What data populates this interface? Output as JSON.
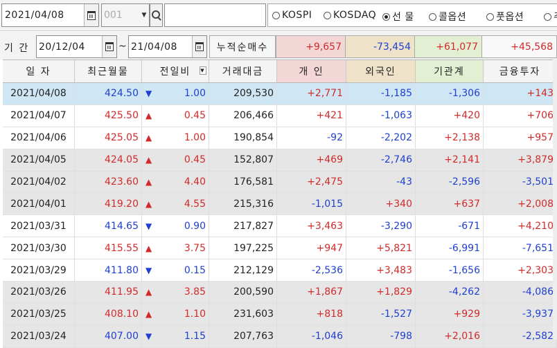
{
  "toolbar": {
    "date": "2021/04/08",
    "code": "001",
    "name": "",
    "markets": [
      {
        "label": "KOSPI",
        "selected": false
      },
      {
        "label": "KOSDAQ",
        "selected": false
      },
      {
        "label": "선 물",
        "selected": true
      },
      {
        "label": "콜옵션",
        "selected": false
      },
      {
        "label": "풋옵션",
        "selected": false
      },
      {
        "label": "주",
        "selected": false
      }
    ]
  },
  "period": {
    "label": "기 간",
    "from": "20/12/04",
    "separator": "~",
    "to": "21/04/08",
    "cum_label": "누적순매수",
    "totals": [
      "+9,657",
      "-73,454",
      "+61,077",
      "+45,568"
    ]
  },
  "colors": {
    "individual": "#f3d7d7",
    "foreign": "#eee3c8",
    "institution": "#e2efd2",
    "selected_row": "#cfe6f5",
    "shade_row": "#e6e6e6",
    "up": "#d22a2a",
    "down": "#1f3fd0"
  },
  "table": {
    "headers": [
      "일 자",
      "최근월물",
      "전일비",
      "거래대금",
      "개 인",
      "외국인",
      "기관계",
      "금융투자"
    ],
    "rows": [
      {
        "date": "2021/04/08",
        "price": "424.50",
        "dir": "down",
        "chg": "1.00",
        "vol": "209,530",
        "ind": "+2,771",
        "frn": "-1,185",
        "inst": "-1,306",
        "fin": "+143"
      },
      {
        "date": "2021/04/07",
        "price": "425.50",
        "dir": "up",
        "chg": "0.45",
        "vol": "206,466",
        "ind": "+421",
        "frn": "-1,063",
        "inst": "+420",
        "fin": "+706"
      },
      {
        "date": "2021/04/06",
        "price": "425.05",
        "dir": "up",
        "chg": "1.00",
        "vol": "190,854",
        "ind": "-92",
        "frn": "-2,202",
        "inst": "+2,138",
        "fin": "+957"
      },
      {
        "date": "2021/04/05",
        "price": "424.05",
        "dir": "up",
        "chg": "0.45",
        "vol": "152,807",
        "ind": "+469",
        "frn": "-2,746",
        "inst": "+2,141",
        "fin": "+3,879"
      },
      {
        "date": "2021/04/02",
        "price": "423.60",
        "dir": "up",
        "chg": "4.40",
        "vol": "176,581",
        "ind": "+2,475",
        "frn": "-43",
        "inst": "-2,596",
        "fin": "-3,501"
      },
      {
        "date": "2021/04/01",
        "price": "419.20",
        "dir": "up",
        "chg": "4.55",
        "vol": "215,316",
        "ind": "-1,015",
        "frn": "+340",
        "inst": "+637",
        "fin": "+2,008"
      },
      {
        "date": "2021/03/31",
        "price": "414.65",
        "dir": "down",
        "chg": "0.90",
        "vol": "217,827",
        "ind": "+3,463",
        "frn": "-3,290",
        "inst": "-671",
        "fin": "+4,210"
      },
      {
        "date": "2021/03/30",
        "price": "415.55",
        "dir": "up",
        "chg": "3.75",
        "vol": "197,225",
        "ind": "+947",
        "frn": "+5,821",
        "inst": "-6,991",
        "fin": "-7,651"
      },
      {
        "date": "2021/03/29",
        "price": "411.80",
        "dir": "down",
        "chg": "0.15",
        "vol": "212,129",
        "ind": "-2,536",
        "frn": "+3,483",
        "inst": "-1,656",
        "fin": "+2,303"
      },
      {
        "date": "2021/03/26",
        "price": "411.95",
        "dir": "up",
        "chg": "3.85",
        "vol": "200,590",
        "ind": "+1,867",
        "frn": "+1,829",
        "inst": "-4,262",
        "fin": "-4,086"
      },
      {
        "date": "2021/03/25",
        "price": "408.10",
        "dir": "up",
        "chg": "1.10",
        "vol": "231,603",
        "ind": "+818",
        "frn": "-1,527",
        "inst": "+929",
        "fin": "-3,937"
      },
      {
        "date": "2021/03/24",
        "price": "407.00",
        "dir": "down",
        "chg": "1.15",
        "vol": "207,763",
        "ind": "-1,046",
        "frn": "-798",
        "inst": "+2,016",
        "fin": "-2,582"
      }
    ]
  }
}
